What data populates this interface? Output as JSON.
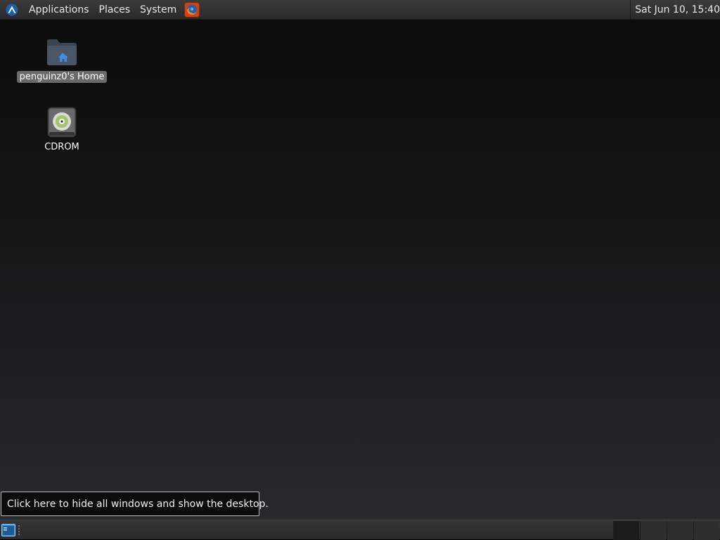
{
  "top_panel": {
    "menus": [
      "Applications",
      "Places",
      "System"
    ],
    "clock": "Sat Jun 10, 15:40",
    "launchers": {
      "browser_icon": "firefox-icon"
    },
    "app_menu_icon": "distro-logo-icon"
  },
  "desktop": {
    "icons": [
      {
        "label": "penguinz0's Home",
        "icon": "home-folder-icon",
        "selected": true
      },
      {
        "label": "CDROM",
        "icon": "cdrom-icon",
        "selected": false
      }
    ]
  },
  "tooltip": {
    "text": "Click here to hide all windows and show the desktop."
  },
  "bottom_panel": {
    "show_desktop_icon": "show-desktop-icon",
    "workspaces": [
      {
        "active": true
      },
      {
        "active": false
      },
      {
        "active": false
      },
      {
        "active": false
      }
    ]
  },
  "colors": {
    "panel": "#2b2b2b",
    "desktop_top": "#0b0b0b",
    "desktop_bottom": "#282b2c",
    "selection": "#6a6a6a",
    "accent_blue": "#2f7fd0"
  }
}
